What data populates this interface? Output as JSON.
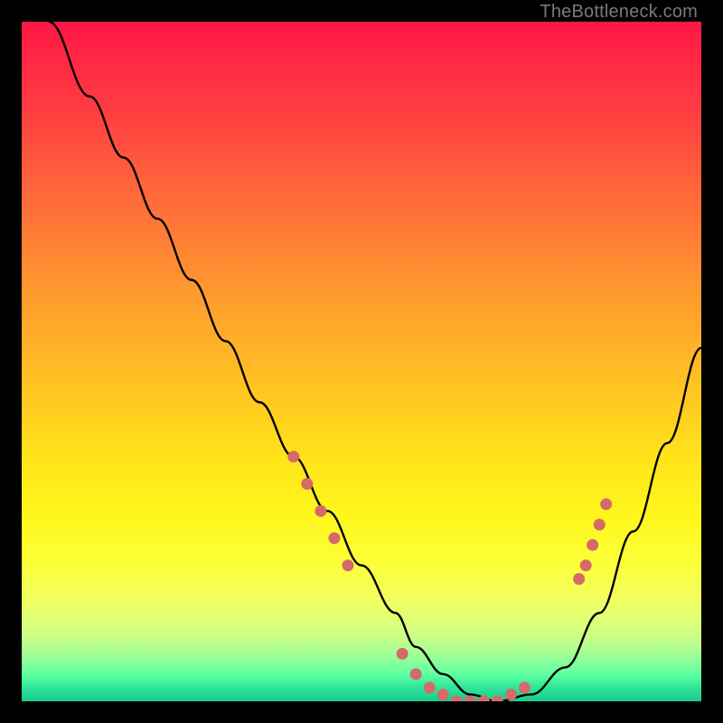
{
  "watermark": "TheBottleneck.com",
  "colors": {
    "frame": "#000000",
    "curve": "#000000",
    "marker": "#d46a6a"
  },
  "chart_data": {
    "type": "line",
    "title": "",
    "xlabel": "",
    "ylabel": "",
    "xlim": [
      0,
      100
    ],
    "ylim": [
      0,
      100
    ],
    "grid": false,
    "legend": false,
    "annotations": [
      "TheBottleneck.com"
    ],
    "series": [
      {
        "name": "bottleneck-curve",
        "x": [
          4,
          10,
          15,
          20,
          25,
          30,
          35,
          40,
          45,
          50,
          55,
          58,
          62,
          66,
          70,
          75,
          80,
          85,
          90,
          95,
          100
        ],
        "y": [
          100,
          89,
          80,
          71,
          62,
          53,
          44,
          36,
          28,
          20,
          13,
          8,
          4,
          1,
          0,
          1,
          5,
          13,
          25,
          38,
          52
        ]
      }
    ],
    "markers": [
      {
        "x": 40,
        "y": 36
      },
      {
        "x": 42,
        "y": 32
      },
      {
        "x": 44,
        "y": 28
      },
      {
        "x": 46,
        "y": 24
      },
      {
        "x": 48,
        "y": 20
      },
      {
        "x": 56,
        "y": 7
      },
      {
        "x": 58,
        "y": 4
      },
      {
        "x": 60,
        "y": 2
      },
      {
        "x": 62,
        "y": 1
      },
      {
        "x": 64,
        "y": 0
      },
      {
        "x": 66,
        "y": 0
      },
      {
        "x": 68,
        "y": 0
      },
      {
        "x": 70,
        "y": 0
      },
      {
        "x": 72,
        "y": 1
      },
      {
        "x": 74,
        "y": 2
      },
      {
        "x": 82,
        "y": 18
      },
      {
        "x": 83,
        "y": 20
      },
      {
        "x": 84,
        "y": 23
      },
      {
        "x": 85,
        "y": 26
      },
      {
        "x": 86,
        "y": 29
      }
    ]
  }
}
